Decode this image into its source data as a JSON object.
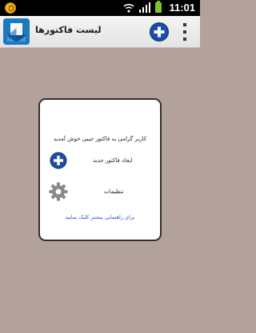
{
  "status_bar": {
    "time": "11:01",
    "icons": [
      "notification-icon",
      "wifi-icon",
      "signal-icon",
      "battery-icon"
    ]
  },
  "action_bar": {
    "title": "لیست فاکتورها",
    "app_icon": "invoice-app-icon",
    "actions": [
      "add-invoice",
      "overflow-menu"
    ]
  },
  "dialog": {
    "welcome": "کاربر گرامی به فاکتور جیبی خوش آمدید",
    "options": [
      {
        "label": "ایجاد فاکتور جدید",
        "icon": "add-circle-icon"
      },
      {
        "label": "تنظیمات",
        "icon": "gear-icon"
      }
    ],
    "help_link": "برای راهنمایی بیشتر کلیک نمایید"
  },
  "colors": {
    "background": "#b3a29c",
    "accent": "#1c4fa3",
    "link": "#2b56c4"
  }
}
